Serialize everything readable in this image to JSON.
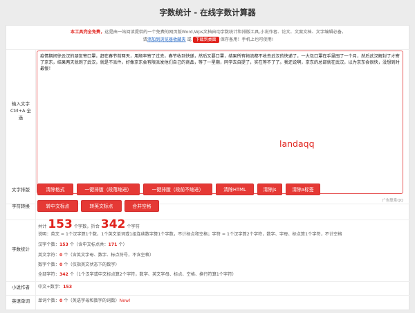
{
  "page_title": "字数统计 - 在线字数计算器",
  "notice": {
    "line1_bold": "本工具完全免费，",
    "line1_rest": "这是由一站阅读提供的一个免费的网页版Word,Wps文档自动字数统计和排版工具,小说作者、论文、文案文档、文字编辑必备。",
    "line2_a": "请",
    "line2_link": "添加到浏览器收藏夹",
    "line2_b": "或",
    "line2_badge": "下载到桌面",
    "line2_c": "保存备用！手机上也可使用!"
  },
  "input": {
    "label_a": "输入文字",
    "label_b": "Ctrl+A 全",
    "label_c": "选",
    "text": "疫情期间徐云汉的朋友寄口罩，赶在春节前两天，用顺丰寄了过去，春节收到快递，然后又要口罩，结果所有物流都不收去武汉的快递了，一大包口罩在手里囤了一个月，然后武汉解封了才寄了京东，结果两天就到了武汉，就是不派件，好像京东会有限派发他们自己的商品，等了一星期，同学去自提了，实在等不了了。我还说啊，京东的总部就在武汉，以为京东会很快，没想到时最慢！",
    "handwriting": "landaqq",
    "ad": "广告联系QQ"
  },
  "format": {
    "label": "文字排版",
    "buttons": [
      "清除格式",
      "一键排版（段落缩进）",
      "一键排版（段前不缩进）",
      "清除HTML",
      "清除js",
      "清除a标签"
    ]
  },
  "convert": {
    "label": "字符转换",
    "buttons": [
      "转中文标点",
      "转英文标点",
      "合并空格"
    ]
  },
  "stats": {
    "label": "字数统计",
    "total_prefix": "共计",
    "total_chars": "153",
    "total_unit": "个字数，折合",
    "total_words": "342",
    "total_words_unit": "个字符",
    "explain": "说明：英文 = 1个汉字算1个数，1个英文单词或1组连续数字算1个字数，不计标点和空格；字符 = 1个汉字算2个字符，数字、字母、标点算1个字符，不计空格",
    "hanzi_label": "汉字个数：",
    "hanzi_value": "153",
    "hanzi_unit": "个（含中文标点共：",
    "hanzi_punct": "171",
    "hanzi_end": "个）",
    "en_label": "英文字符：",
    "en_value": "0",
    "en_unit": "个（含英文字母、数字、标点符号，不含空格）",
    "digit_label": "数字个数：",
    "digit_value": "0",
    "digit_unit": "个（仅指英文状态下的数字）",
    "all_label": "全部字符：",
    "all_value": "342",
    "all_unit": "个（1个汉字或中文标点算2个字符，数字、英文字母、标点、空格、换行符算1个字符）"
  },
  "novel": {
    "label": "小说作者",
    "text": "中文+数字：",
    "value": "153"
  },
  "english": {
    "label": "英语单词",
    "text": "单词个数：",
    "value": "0",
    "unit": "个（英语字母和数字的词数）",
    "new": "New!"
  }
}
